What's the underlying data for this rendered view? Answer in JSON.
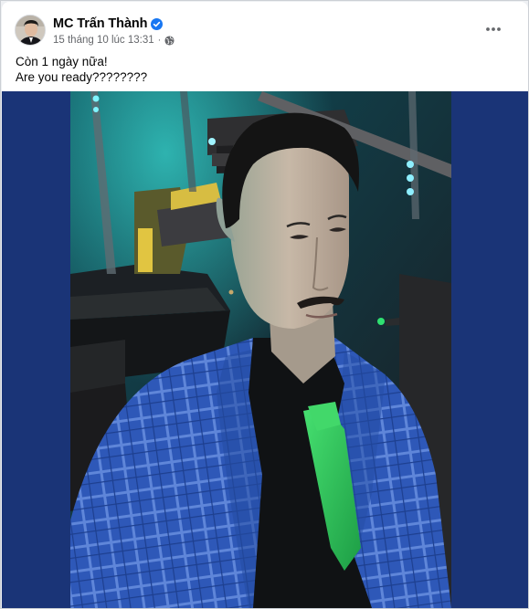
{
  "post": {
    "author_name": "MC Trấn Thành",
    "timestamp": "15 tháng 10 lúc 13:31",
    "separator": "·",
    "caption_lines": [
      "Còn 1 ngày nữa!",
      "Are you ready????????"
    ],
    "more_label": "•••"
  },
  "icons": {
    "verified": "verified-badge-icon",
    "audience": "globe-icon",
    "more": "more-options-icon"
  },
  "colors": {
    "verified_blue": "#1877f2",
    "media_background": "#1a3477",
    "secondary_text": "#65676b"
  }
}
